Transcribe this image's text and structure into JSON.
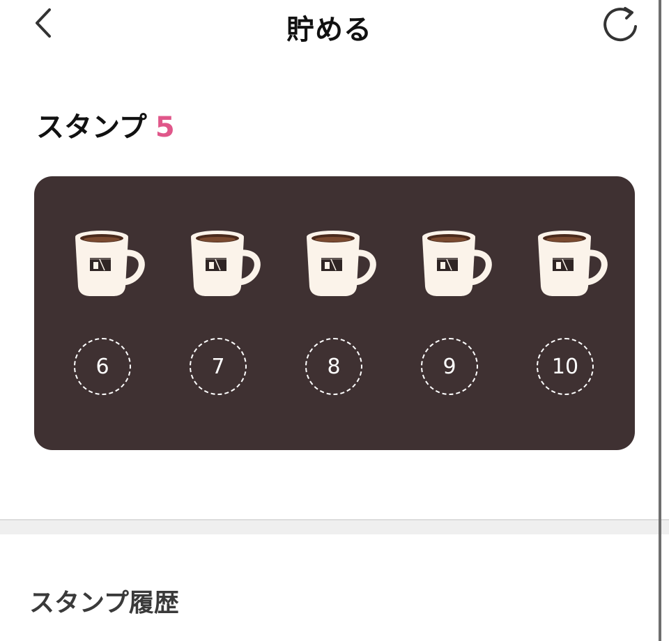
{
  "header": {
    "title": "貯める",
    "back_icon": "chevron-left-icon",
    "refresh_icon": "refresh-icon"
  },
  "stamps": {
    "label": "スタンプ",
    "count": "5",
    "count_color": "#e0578a",
    "card_color": "#3f3132",
    "collected": [
      {
        "icon": "coffee-cup-icon"
      },
      {
        "icon": "coffee-cup-icon"
      },
      {
        "icon": "coffee-cup-icon"
      },
      {
        "icon": "coffee-cup-icon"
      },
      {
        "icon": "coffee-cup-icon"
      }
    ],
    "empty_slots": [
      "6",
      "7",
      "8",
      "9",
      "10"
    ]
  },
  "history": {
    "title": "スタンプ履歴"
  }
}
